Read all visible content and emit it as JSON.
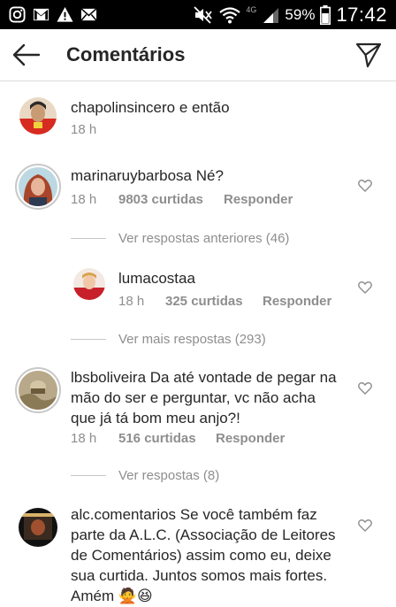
{
  "status_bar": {
    "network": "4G",
    "battery": "59%",
    "time": "17:42"
  },
  "header": {
    "title": "Comentários"
  },
  "caption": {
    "username": "chapolinsincero",
    "text": "e então",
    "time": "18 h"
  },
  "comments": [
    {
      "username": "marinaruybarbosa",
      "text": "Né?",
      "time": "18 h",
      "likes": "9803 curtidas",
      "reply": "Responder",
      "view_replies": "Ver respostas anteriores (46)"
    },
    {
      "username": "lumacostaa",
      "text": "",
      "time": "18 h",
      "likes": "325 curtidas",
      "reply": "Responder",
      "view_replies": "Ver mais respostas (293)"
    },
    {
      "username": "lbsboliveira",
      "text_lines": [
        "Da até vontade de pegar na",
        "mão do ser e perguntar, vc não acha",
        "que já tá bom meu anjo?!"
      ],
      "time": "18 h",
      "likes": "516 curtidas",
      "reply": "Responder",
      "view_replies": "Ver respostas (8)"
    },
    {
      "username": "alc.comentarios",
      "text_lines": [
        "Se você também faz",
        "parte da A.L.C. (Associação de Leitores",
        "de Comentários) assim como eu, deixe",
        "sua curtida. Juntos somos mais fortes.",
        "Amém 🙅😆"
      ]
    }
  ]
}
